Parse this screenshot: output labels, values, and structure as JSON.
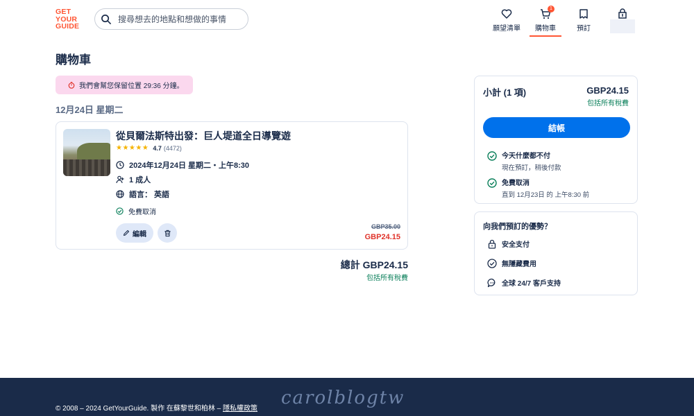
{
  "header": {
    "logo": [
      "GET",
      "YOUR",
      "GUIDE"
    ],
    "search_placeholder": "搜尋想去的地點和想做的事情",
    "nav": {
      "wishlist": "願望清單",
      "cart": "購物車",
      "cart_count": "1",
      "bookings": "預訂"
    }
  },
  "page": {
    "title": "購物車",
    "hold_notice": "我們會幫您保留位置 29:36 分鐘。",
    "date_heading": "12月24日 星期二"
  },
  "item": {
    "title": "從貝爾法斯特出發：巨人堤道全日導覽遊",
    "stars": "★★★★★",
    "rating": "4.7",
    "review_count": "(4472)",
    "datetime": "2024年12月24日 星期二・上午8:30",
    "participants": "1 成人",
    "language": "語言： 英語",
    "cancellation": "免費取消",
    "edit_label": "編輯",
    "old_price": "GBP35.00",
    "new_price": "GBP24.15"
  },
  "total": {
    "label": "總計 GBP24.15",
    "tax_note": "包括所有稅費"
  },
  "summary": {
    "subtotal_label": "小計 (1 項)",
    "subtotal_value": "GBP24.15",
    "tax_note": "包括所有稅費",
    "checkout_label": "結帳",
    "benefits": [
      {
        "title": "今天什麼都不付",
        "subtitle": "現在預訂，稍後付款"
      },
      {
        "title": "免費取消",
        "subtitle": "直到 12月23日 的 上午8:30 前"
      }
    ]
  },
  "advantages": {
    "title": "向我們預訂的優勢？",
    "items": [
      "安全支付",
      "無隱藏費用",
      "全球 24/7 客戶支持"
    ]
  },
  "footer": {
    "copyright": "© 2008 – 2024 GetYourGuide. 製作 在蘇黎世和柏林 – ",
    "privacy_link": "隱私權政策",
    "watermark": "carolblogtw"
  },
  "colors": {
    "brand": "#ff5533",
    "primary_button": "#0071eb",
    "price_sale": "#e0332a",
    "tax_green": "#0a7f5a",
    "footer_bg": "#1a2b49",
    "hold_banner_bg": "#fbd8ee"
  }
}
